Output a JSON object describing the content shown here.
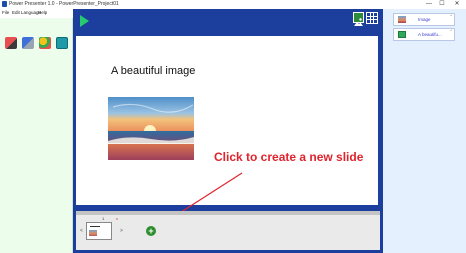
{
  "window": {
    "title": "Power Presenter 1.0 - PowerPresenter_Project01",
    "minimize": "—",
    "maximize": "☐",
    "close": "✕"
  },
  "menu": [
    "File",
    "Edit",
    "Language",
    "Help"
  ],
  "toolbox": {
    "tools": [
      "slide-tool-icon",
      "camera-tool-icon",
      "shapes-tool-icon",
      "screen-tool-icon"
    ]
  },
  "toolbar": {
    "play_icon": "play-icon",
    "image_icon": "image-icon",
    "grid_icon": "grid-icon"
  },
  "slide": {
    "title": "A beautiful image"
  },
  "annotation": {
    "text": "Click to create a new slide",
    "color": "#e0242e"
  },
  "filmstrip": {
    "slide_number": "1",
    "delete_mark": "x",
    "prev": "<",
    "next": ">",
    "add_label": "+"
  },
  "layers": [
    {
      "label": "Image",
      "icon": "image-layer-icon",
      "up": "^",
      "down": "v"
    },
    {
      "label": "A beautifu...",
      "icon": "text-layer-icon",
      "up": "^",
      "down": "v"
    }
  ],
  "colors": {
    "stage": "#1c3f9e",
    "left_panel": "#ecfdec",
    "right_panel": "#e4f0fd",
    "accent_green": "#27c96e"
  }
}
